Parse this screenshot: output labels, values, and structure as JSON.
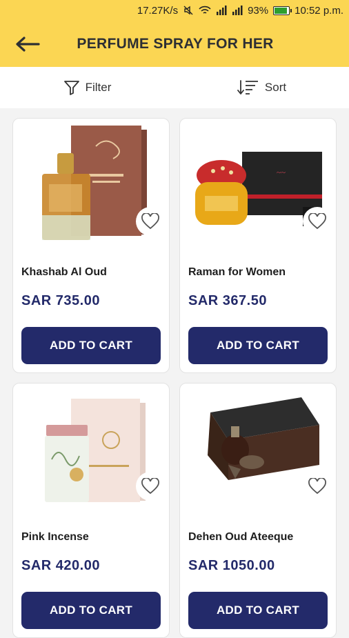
{
  "status_bar": {
    "speed": "17.27K/s",
    "battery": "93%",
    "battery_level": 0.93,
    "time": "10:52 p.m."
  },
  "header": {
    "title": "PERFUME SPRAY FOR HER",
    "back_icon": "arrow-left-icon"
  },
  "filter_bar": {
    "filter_label": "Filter",
    "sort_label": "Sort"
  },
  "colors": {
    "header_bg": "#fbd653",
    "primary": "#232a6a",
    "page_bg": "#f3f3f3"
  },
  "products": [
    {
      "name": "Khashab Al Oud",
      "price": "SAR 735.00",
      "button": "ADD TO CART"
    },
    {
      "name": "Raman for Women",
      "price": "SAR 367.50",
      "button": "ADD TO CART"
    },
    {
      "name": "Pink Incense",
      "price": "SAR 420.00",
      "button": "ADD TO CART"
    },
    {
      "name": "Dehen Oud Ateeque",
      "price": "SAR 1050.00",
      "button": "ADD TO CART"
    }
  ]
}
